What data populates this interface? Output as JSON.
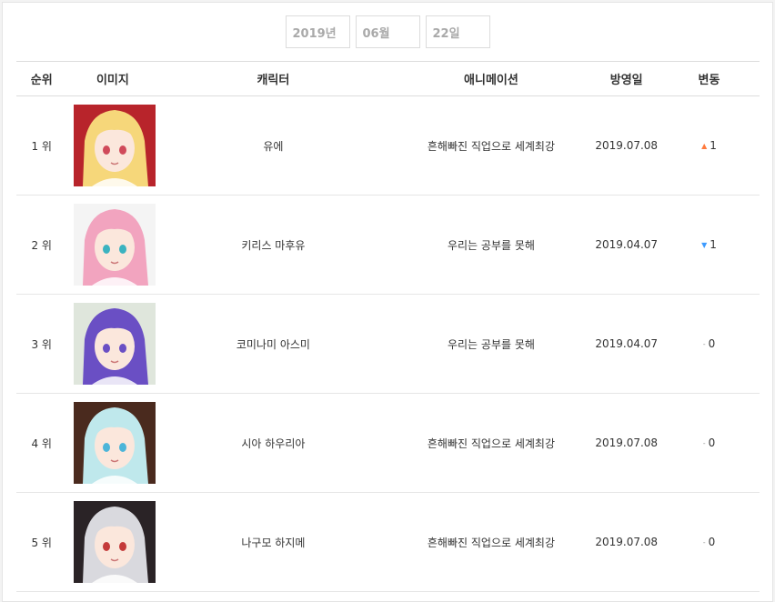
{
  "date_selector": {
    "year": "2019년",
    "month": "06월",
    "day": "22일"
  },
  "table": {
    "headers": {
      "rank": "순위",
      "image": "이미지",
      "character": "캐릭터",
      "animation": "애니메이션",
      "air_date": "방영일",
      "change": "변동"
    },
    "rows": [
      {
        "rank": "1 위",
        "character": "유에",
        "animation": "흔해빠진 직업으로 세계최강",
        "air_date": "2019.07.08",
        "change_symbol": "▲",
        "change_dir": "up",
        "change_value": "1",
        "colors": {
          "hair": "#f6d77a",
          "bg": "#b8242b",
          "eye": "#d04a5a"
        }
      },
      {
        "rank": "2 위",
        "character": "키리스 마후유",
        "animation": "우리는 공부를 못해",
        "air_date": "2019.04.07",
        "change_symbol": "▼",
        "change_dir": "down",
        "change_value": "1",
        "colors": {
          "hair": "#f2a4bf",
          "bg": "#f4f4f4",
          "eye": "#3bb3c0"
        }
      },
      {
        "rank": "3 위",
        "character": "코미나미 아스미",
        "animation": "우리는 공부를 못해",
        "air_date": "2019.04.07",
        "change_symbol": "-",
        "change_dir": "same",
        "change_value": "0",
        "colors": {
          "hair": "#6a4fc4",
          "bg": "#dfe6dc",
          "eye": "#6a4fc4"
        }
      },
      {
        "rank": "4 위",
        "character": "시아 하우리아",
        "animation": "흔해빠진 직업으로 세계최강",
        "air_date": "2019.07.08",
        "change_symbol": "-",
        "change_dir": "same",
        "change_value": "0",
        "colors": {
          "hair": "#bfe8ec",
          "bg": "#4a2a1e",
          "eye": "#4cb5d9"
        }
      },
      {
        "rank": "5 위",
        "character": "나구모 하지메",
        "animation": "흔해빠진 직업으로 세계최강",
        "air_date": "2019.07.08",
        "change_symbol": "-",
        "change_dir": "same",
        "change_value": "0",
        "colors": {
          "hair": "#d9d9de",
          "bg": "#2a2326",
          "eye": "#c43a3a"
        }
      }
    ]
  }
}
